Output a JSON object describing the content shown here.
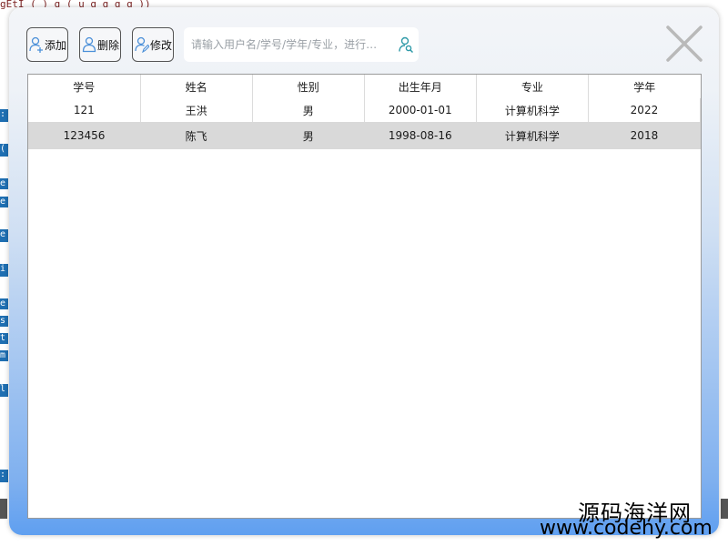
{
  "background": {
    "top_line": "gEtI  (       )       g          (          u g       g    g  g  ))",
    "gutter_chars": [
      ":",
      "(",
      "e",
      "e",
      "e",
      "i",
      "e",
      "s",
      "t",
      "m",
      "l",
      ":"
    ]
  },
  "toolbar": {
    "add_label": "添加",
    "delete_label": "删除",
    "edit_label": "修改"
  },
  "search": {
    "placeholder": "请输入用户名/学号/学年/专业，进行…",
    "value": ""
  },
  "table": {
    "columns": [
      "学号",
      "姓名",
      "性别",
      "出生年月",
      "专业",
      "学年"
    ],
    "rows": [
      [
        "121",
        "王洪",
        "男",
        "2000-01-01",
        "计算机科学",
        "2022"
      ],
      [
        "123456",
        "陈飞",
        "男",
        "1998-08-16",
        "计算机科学",
        "2018"
      ]
    ]
  },
  "watermark": {
    "line1": "源码海洋网",
    "line2": "www.codehy.com"
  },
  "colors": {
    "selected_row": "#d9d9d9",
    "dialog_gradient_bottom": "#5f9ff0",
    "icon_blue": "#4a8fd8"
  }
}
